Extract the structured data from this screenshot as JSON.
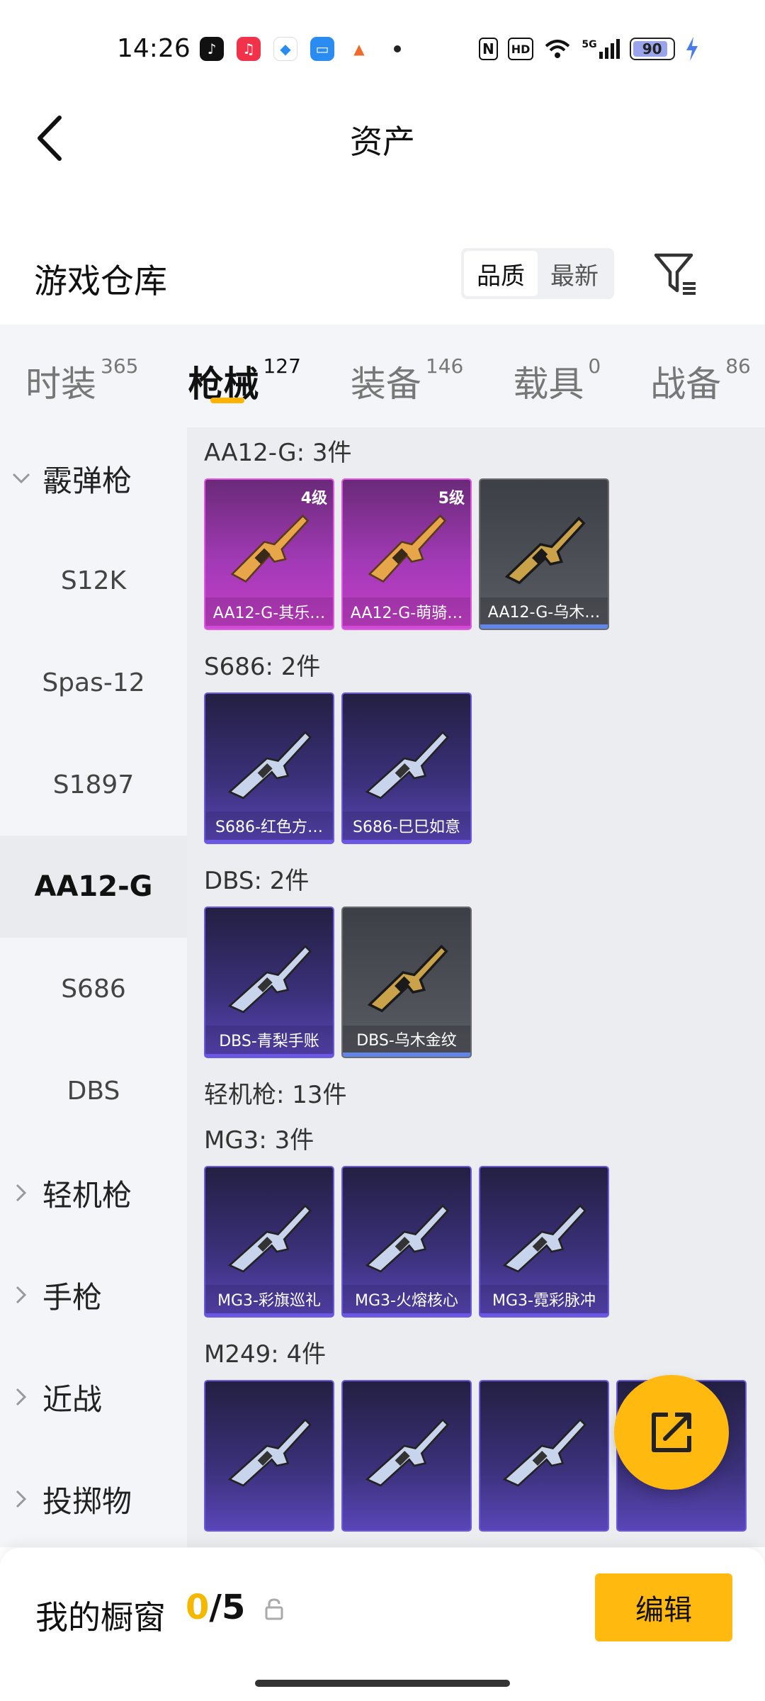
{
  "statusbar": {
    "time": "14:26",
    "battery": "90",
    "nfc": "N",
    "hd": "HD",
    "net": "5G"
  },
  "nav": {
    "title": "资产"
  },
  "warehouse": {
    "title": "游戏仓库",
    "sort_options": [
      "品质",
      "最新"
    ],
    "active_sort": "品质"
  },
  "category_tabs": [
    {
      "label": "时装",
      "count": "365"
    },
    {
      "label": "枪械",
      "count": "127"
    },
    {
      "label": "装备",
      "count": "146"
    },
    {
      "label": "载具",
      "count": "0"
    },
    {
      "label": "战备",
      "count": "86"
    }
  ],
  "active_category": "枪械",
  "sidebar": {
    "groups": [
      {
        "label": "霰弹枪",
        "expanded": true,
        "items": [
          "S12K",
          "Spas-12",
          "S1897",
          "AA12-G",
          "S686",
          "DBS"
        ]
      },
      {
        "label": "轻机枪",
        "expanded": false
      },
      {
        "label": "手枪",
        "expanded": false
      },
      {
        "label": "近战",
        "expanded": false
      },
      {
        "label": "投掷物",
        "expanded": false
      }
    ],
    "active_item": "AA12-G"
  },
  "sections": [
    {
      "title": "AA12-G: 3件",
      "cards": [
        {
          "name": "AA12-G-其乐…",
          "level": "4级",
          "rarity": "pink"
        },
        {
          "name": "AA12-G-萌骑…",
          "level": "5级",
          "rarity": "pink"
        },
        {
          "name": "AA12-G-乌木…",
          "level": "",
          "rarity": "gray"
        }
      ]
    },
    {
      "title": "S686: 2件",
      "cards": [
        {
          "name": "S686-红色方…",
          "level": "",
          "rarity": "purple"
        },
        {
          "name": "S686-巳巳如意",
          "level": "",
          "rarity": "purple"
        }
      ]
    },
    {
      "title": "DBS: 2件",
      "cards": [
        {
          "name": "DBS-青梨手账",
          "level": "",
          "rarity": "purple"
        },
        {
          "name": "DBS-乌木金纹",
          "level": "",
          "rarity": "gray"
        }
      ]
    },
    {
      "title": "轻机枪: 13件",
      "cards": []
    },
    {
      "title": "MG3: 3件",
      "cards": [
        {
          "name": "MG3-彩旗巡礼",
          "level": "",
          "rarity": "purple"
        },
        {
          "name": "MG3-火熔核心",
          "level": "",
          "rarity": "purple"
        },
        {
          "name": "MG3-霓彩脉冲",
          "level": "",
          "rarity": "purple"
        }
      ]
    },
    {
      "title": "M249: 4件",
      "cards": [
        {
          "name": "",
          "level": "",
          "rarity": "purple"
        },
        {
          "name": "",
          "level": "",
          "rarity": "purple"
        },
        {
          "name": "",
          "level": "",
          "rarity": "purple"
        },
        {
          "name": "",
          "level": "",
          "rarity": "purple"
        }
      ]
    }
  ],
  "showcase": {
    "title": "我的橱窗",
    "current": "0",
    "total": "/5",
    "edit_label": "编辑"
  },
  "colors": {
    "accent": "#ffb90f",
    "pink_card": "#b43cc0",
    "purple_card": "#3c317c",
    "gray_card": "#55575e"
  }
}
